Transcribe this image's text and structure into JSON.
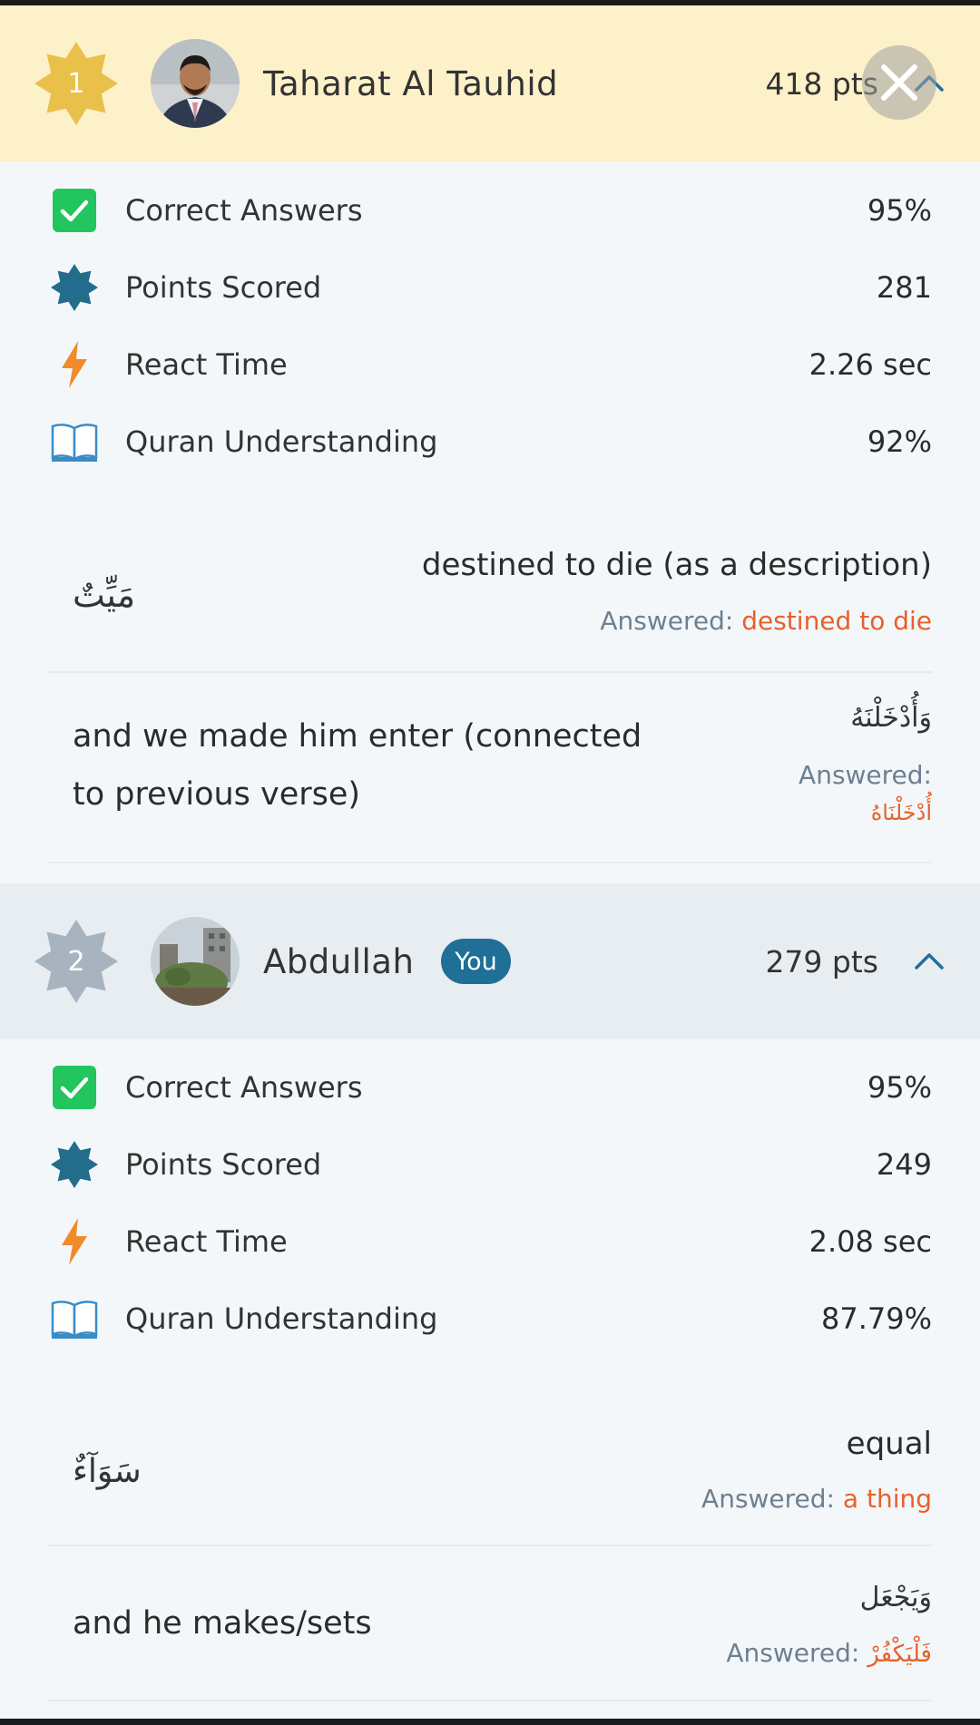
{
  "colors": {
    "gold": "#e9c04a",
    "silver": "#a7b4c0",
    "accent": "#1f6f96",
    "answer_wrong": "#e8602c",
    "check_green": "#22c55e",
    "bolt_orange": "#f08a2a"
  },
  "players": [
    {
      "rank": "1",
      "name": "Taharat Al Tauhid",
      "points": "418 pts",
      "stats": [
        {
          "label": "Correct Answers",
          "value": "95%",
          "icon": "check-icon"
        },
        {
          "label": "Points Scored",
          "value": "281",
          "icon": "star-badge-icon"
        },
        {
          "label": "React Time",
          "value": "2.26 sec",
          "icon": "lightning-icon"
        },
        {
          "label": "Quran Understanding",
          "value": "92%",
          "icon": "book-icon"
        }
      ],
      "questions": [
        {
          "arabic": "مَيِّتٌ",
          "meaning": "destined to die (as a description)",
          "answered_label": "Answered:",
          "answered": "destined to die"
        },
        {
          "arabic": "وَأُدْخَلْنَهُ",
          "meaning_line1": "and we made him enter (connected",
          "meaning_line2": "to previous verse)",
          "answered_label": "Answered:",
          "answered": "أُدْخَلْنَاهُ"
        }
      ]
    },
    {
      "rank": "2",
      "name": "Abdullah",
      "you_badge": "You",
      "points": "279 pts",
      "stats": [
        {
          "label": "Correct Answers",
          "value": "95%",
          "icon": "check-icon"
        },
        {
          "label": "Points Scored",
          "value": "249",
          "icon": "star-badge-icon"
        },
        {
          "label": "React Time",
          "value": "2.08 sec",
          "icon": "lightning-icon"
        },
        {
          "label": "Quran Understanding",
          "value": "87.79%",
          "icon": "book-icon"
        }
      ],
      "questions": [
        {
          "arabic": "سَوَآءٌ",
          "meaning": "equal",
          "answered_label": "Answered:",
          "answered": "a thing"
        },
        {
          "arabic": "وَيَجْعَل",
          "meaning": "and he makes/sets",
          "answered_label": "Answered:",
          "answered": "فَلْيَكْفُرْ"
        }
      ]
    }
  ]
}
